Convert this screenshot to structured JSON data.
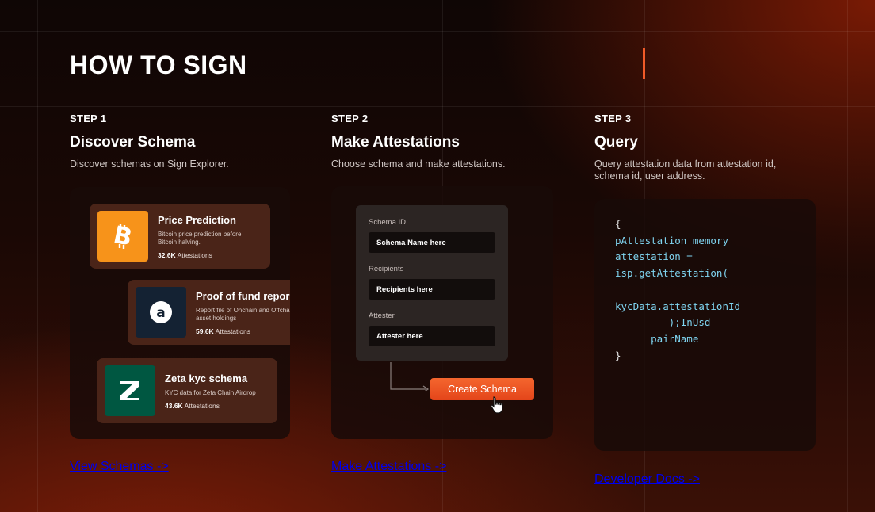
{
  "title": "HOW TO SIGN",
  "steps": [
    {
      "step": "STEP 1",
      "heading": "Discover Schema",
      "desc": "Discover schemas on Sign Explorer.",
      "link": "View Schemas ->",
      "cards": [
        {
          "title": "Price Prediction",
          "desc": "Bitcoin price prediction before Bitcoin halving.",
          "count": "32.6K",
          "count_suffix": " Attestations",
          "icon": "bitcoin-icon",
          "color": "#f7931a"
        },
        {
          "title": "Proof of fund repor",
          "desc": "Report file of Onchain and Offchain asset holdings",
          "count": "59.6K",
          "count_suffix": " Attestations",
          "icon": "letter-a-icon",
          "color": "#142233"
        },
        {
          "title": "Zeta kyc schema",
          "desc": "KYC data for Zeta Chain Airdrop",
          "count": "43.6K",
          "count_suffix": " Attestations",
          "icon": "zeta-icon",
          "color": "#005741"
        }
      ]
    },
    {
      "step": "STEP 2",
      "heading": "Make Attestations",
      "desc": "Choose schema and make attestations.",
      "link": "Make Attestations ->",
      "form": {
        "schema_label": "Schema ID",
        "schema_value": "Schema Name here",
        "recipients_label": "Recipients",
        "recipients_value": "Recipients here",
        "attester_label": "Attester",
        "attester_value": "Attester here",
        "button": "Create Schema"
      }
    },
    {
      "step": "STEP 3",
      "heading": "Query",
      "desc": "Query attestation data from attestation id, schema id, user address.",
      "link": "Developer Docs ->",
      "code": {
        "l1": "{",
        "l2": "pAttestation memory",
        "l3": "attestation =",
        "l4": "isp.getAttestation(",
        "l5": "kycData.attestationId",
        "l6": ");InUsd",
        "l7": "pairName",
        "l8": "}"
      }
    }
  ],
  "colors": {
    "accent": "#f05a28",
    "code": "#7fd4f0"
  }
}
